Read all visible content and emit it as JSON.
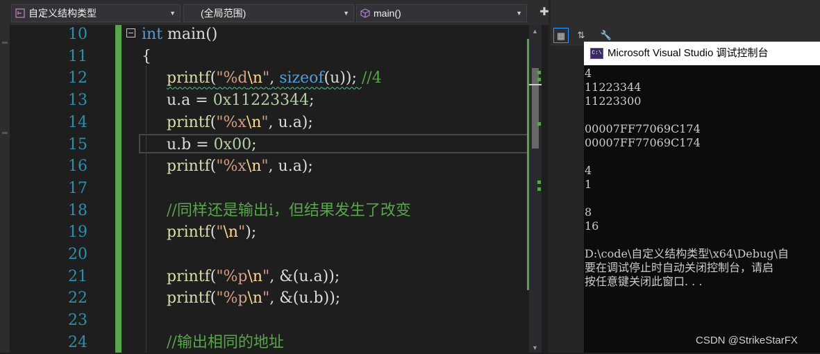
{
  "navbar": {
    "project_scope": "自定义结构类型",
    "global_scope": "(全局范围)",
    "member_scope": "main()"
  },
  "editor": {
    "line_numbers": [
      "10",
      "11",
      "12",
      "13",
      "14",
      "15",
      "16",
      "17",
      "18",
      "19",
      "20",
      "21",
      "22",
      "23",
      "24"
    ],
    "code": {
      "l10_kw": "int",
      "l10_rest": " main()",
      "l11": "{",
      "l12_fn": "printf",
      "l12_open": "(",
      "l12_str_a": "\"%d",
      "l12_esc": "\\n",
      "l12_str_b": "\"",
      "l12_mid": ", ",
      "l12_kw": "sizeof",
      "l12_args": "(u)); ",
      "l12_cm": "//4",
      "l13_a": "u.a = ",
      "l13_num": "0x11223344",
      "l13_end": ";",
      "l14_fn": "printf",
      "l14_open": "(",
      "l14_str_a": "\"%x",
      "l14_esc": "\\n",
      "l14_str_b": "\"",
      "l14_rest": ", u.a);",
      "l15_a": "u.b = ",
      "l15_num": "0x00",
      "l15_end": ";",
      "l16_fn": "printf",
      "l16_open": "(",
      "l16_str_a": "\"%x",
      "l16_esc": "\\n",
      "l16_str_b": "\"",
      "l16_rest": ", u.a);",
      "l18_cm": "//同样还是输出i，但结果发生了改变",
      "l19_fn": "printf",
      "l19_open": "(",
      "l19_str_a": "\"",
      "l19_esc": "\\n",
      "l19_str_b": "\"",
      "l19_rest": ");",
      "l21_fn": "printf",
      "l21_open": "(",
      "l21_str_a": "\"%p",
      "l21_esc": "\\n",
      "l21_str_b": "\"",
      "l21_rest": ", &(u.a));",
      "l22_fn": "printf",
      "l22_open": "(",
      "l22_str_a": "\"%p",
      "l22_esc": "\\n",
      "l22_str_b": "\"",
      "l22_rest": ", &(u.b));",
      "l24_cm": "//输出相同的地址"
    }
  },
  "console": {
    "title": "Microsoft Visual Studio 调试控制台",
    "icon_text": "C:\\",
    "lines": [
      "4",
      "11223344",
      "11223300",
      "",
      "00007FF77069C174",
      "00007FF77069C174",
      "",
      "4",
      "1",
      "",
      "8",
      "16",
      "",
      "D:\\code\\自定义结构类型\\x64\\Debug\\自",
      "要在调试停止时自动关闭控制台，请启",
      "按任意键关闭此窗口. . ."
    ]
  },
  "watermark": "CSDN @StrikeStarFX",
  "colors": {
    "keyword": "#569cd6",
    "function": "#dcdcaa",
    "string": "#d69d85",
    "number": "#b5cea8",
    "comment": "#57a64a",
    "line_number": "#2b91af"
  }
}
